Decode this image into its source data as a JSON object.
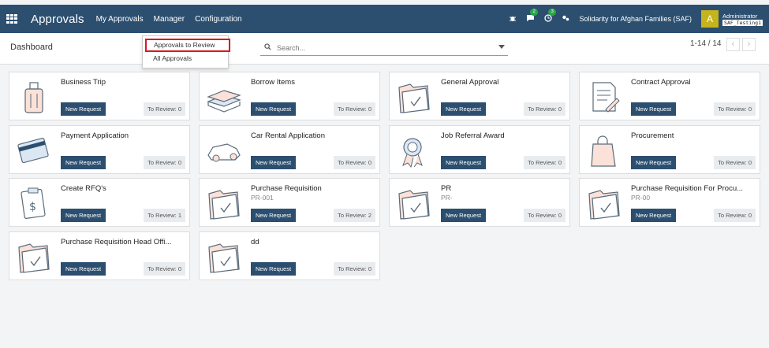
{
  "topbar": {
    "app_title": "Approvals",
    "nav": [
      "My Approvals",
      "Manager",
      "Configuration"
    ],
    "chat_badge": "2",
    "activity_badge": "3",
    "company": "Solidarity for Afghan Families (SAF)",
    "avatar_letter": "A",
    "user_name": "Administrator",
    "db_name": "SAF_Testing1"
  },
  "control": {
    "breadcrumb": "Dashboard",
    "search_placeholder": "Search...",
    "pager": "1-14 / 14"
  },
  "dropdown": {
    "items": [
      "Approvals to Review",
      "All Approvals"
    ]
  },
  "labels": {
    "new_request": "New Request"
  },
  "cards": [
    {
      "title": "Business Trip",
      "subtitle": "",
      "review": "To Review: 0",
      "icon": "luggage-icon"
    },
    {
      "title": "Borrow Items",
      "subtitle": "",
      "review": "To Review: 0",
      "icon": "books-icon"
    },
    {
      "title": "General Approval",
      "subtitle": "",
      "review": "To Review: 0",
      "icon": "folder-check-icon"
    },
    {
      "title": "Contract Approval",
      "subtitle": "",
      "review": "To Review: 0",
      "icon": "contract-icon"
    },
    {
      "title": "Payment Application",
      "subtitle": "",
      "review": "To Review: 0",
      "icon": "credit-card-icon"
    },
    {
      "title": "Car Rental Application",
      "subtitle": "",
      "review": "To Review: 0",
      "icon": "car-icon"
    },
    {
      "title": "Job Referral Award",
      "subtitle": "",
      "review": "To Review: 0",
      "icon": "award-icon"
    },
    {
      "title": "Procurement",
      "subtitle": "",
      "review": "To Review: 0",
      "icon": "shopping-bag-icon"
    },
    {
      "title": "Create RFQ's",
      "subtitle": "",
      "review": "To Review: 1",
      "icon": "clipboard-dollar-icon"
    },
    {
      "title": "Purchase Requisition",
      "subtitle": "PR-001",
      "review": "To Review: 2",
      "icon": "folder-check-icon"
    },
    {
      "title": "PR",
      "subtitle": "PR-",
      "review": "To Review: 0",
      "icon": "folder-check-icon"
    },
    {
      "title": "Purchase Requisition For Procu...",
      "subtitle": "PR-00",
      "review": "To Review: 0",
      "icon": "folder-check-icon"
    },
    {
      "title": "Purchase Requisition Head Offi...",
      "subtitle": "",
      "review": "To Review: 0",
      "icon": "folder-check-icon"
    },
    {
      "title": "dd",
      "subtitle": "",
      "review": "To Review: 0",
      "icon": "folder-check-icon"
    }
  ]
}
